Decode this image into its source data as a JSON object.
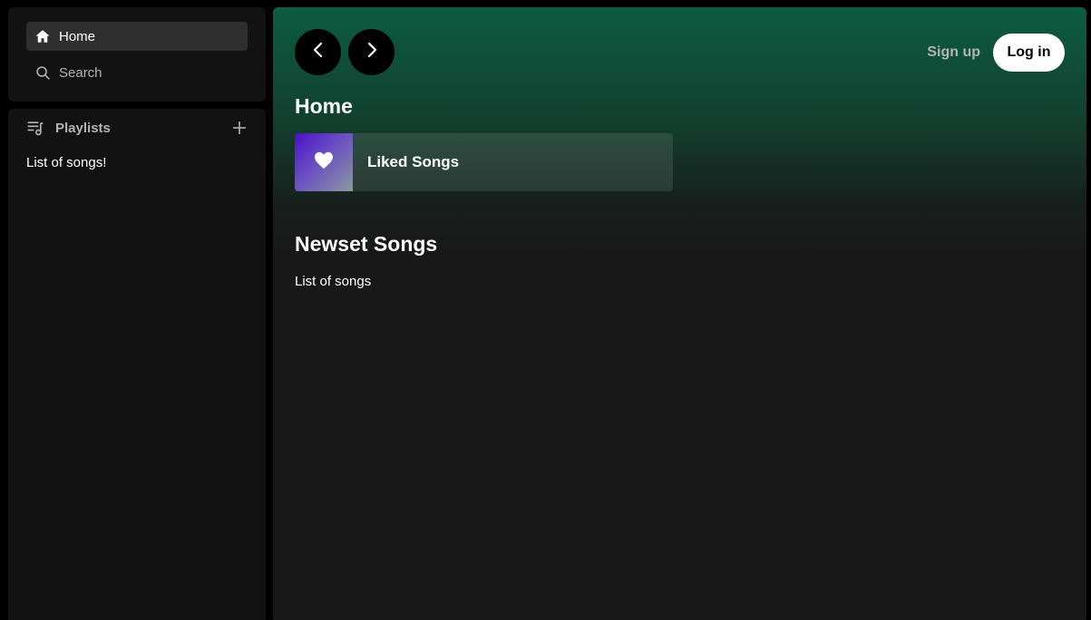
{
  "sidebar": {
    "nav": {
      "home_label": "Home",
      "search_label": "Search"
    },
    "library": {
      "title": "Playlists",
      "content_text": "List of songs!"
    }
  },
  "header": {
    "back_icon": "chevron-left-icon",
    "forward_icon": "chevron-right-icon",
    "signup_label": "Sign up",
    "login_label": "Log in"
  },
  "main": {
    "title": "Home",
    "liked_card": {
      "label": "Liked Songs",
      "icon": "heart-icon"
    },
    "newest": {
      "title": "Newset Songs",
      "content_text": "List of songs"
    }
  },
  "colors": {
    "accent_green": "#0c5c42",
    "sidebar_bg": "#121212",
    "main_bg": "#181818",
    "muted_text": "#b3b3b3"
  }
}
